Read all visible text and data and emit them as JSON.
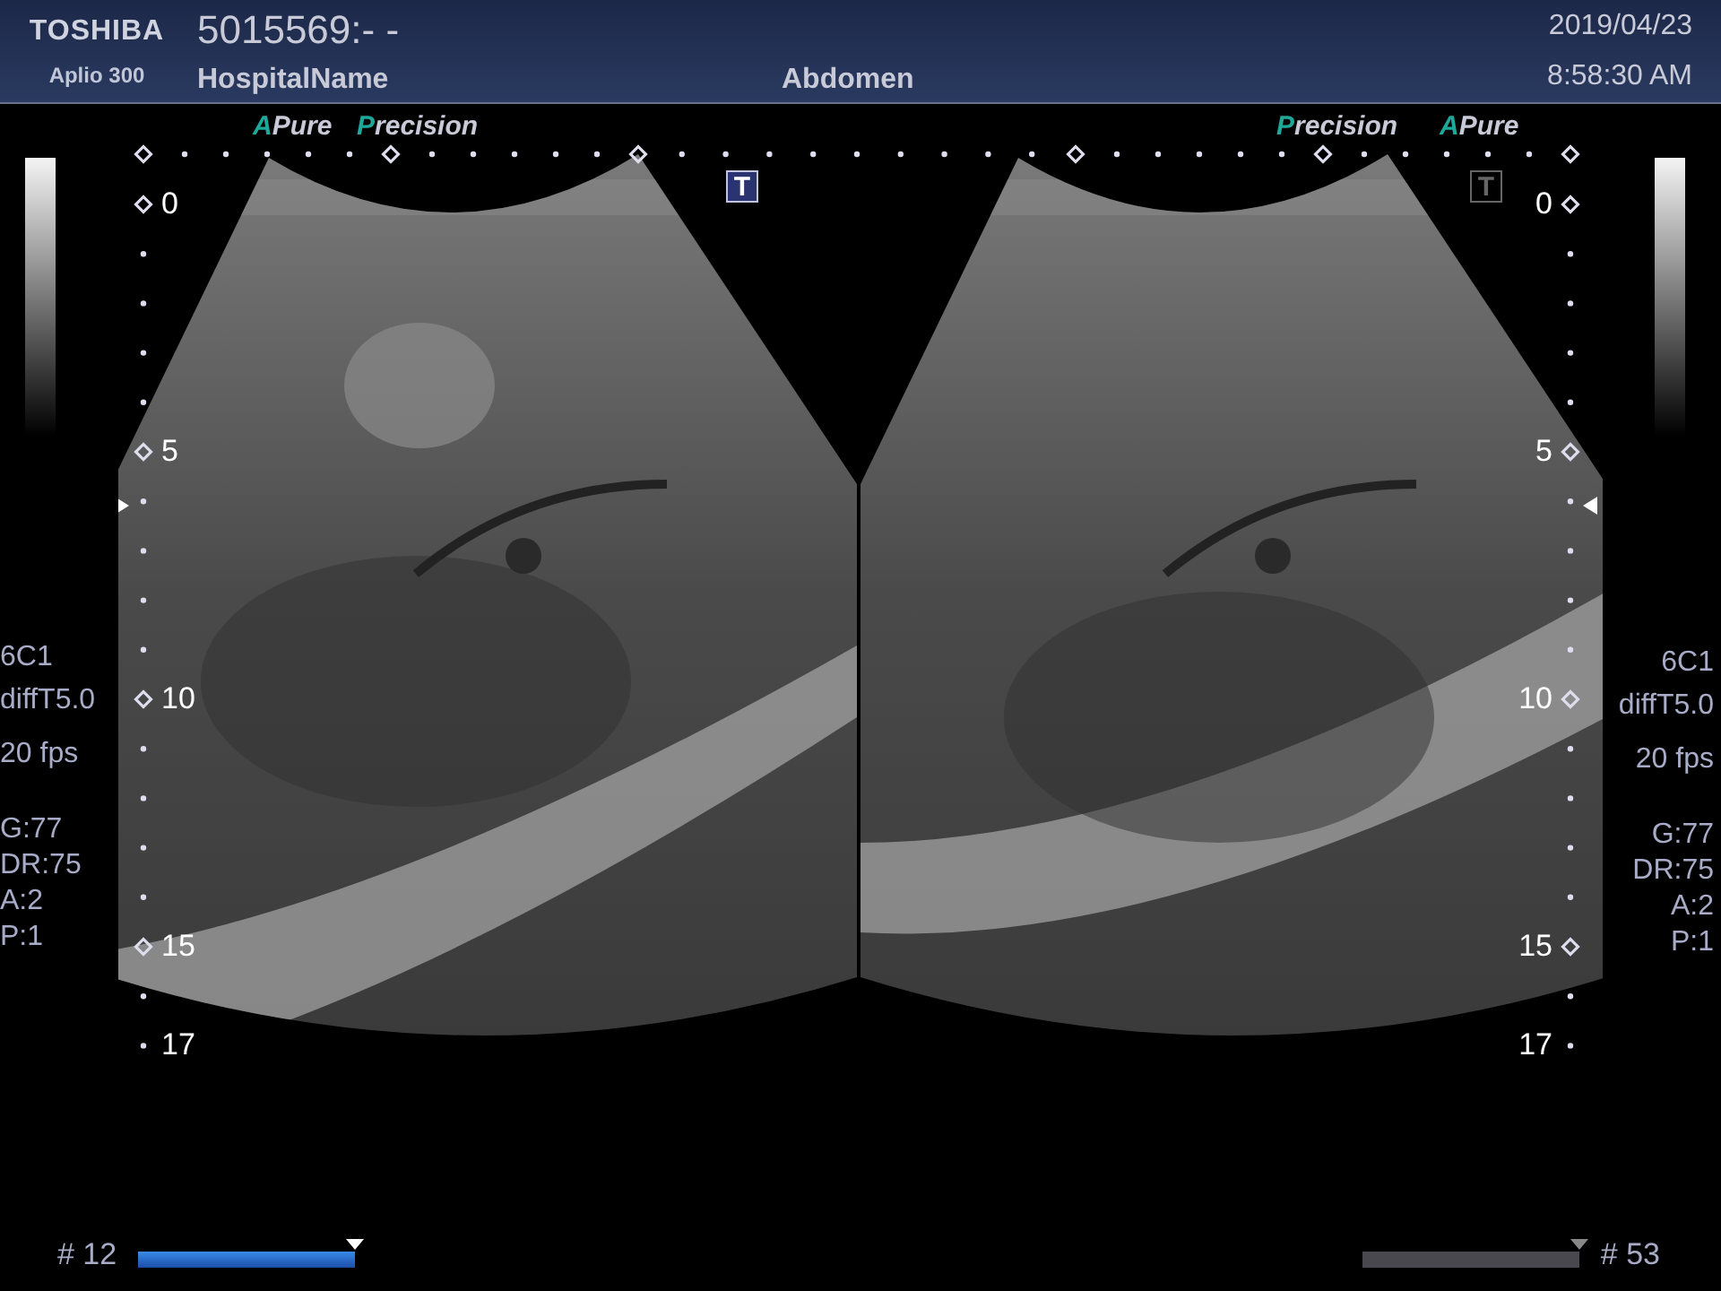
{
  "header": {
    "brand": "TOSHIBA",
    "model": "Aplio 300",
    "patient_id": "5015569:- -",
    "hospital": "HospitalName",
    "exam": "Abdomen",
    "date": "2019/04/23",
    "time": "8:58:30 AM"
  },
  "left_panel": {
    "params": [
      "6C1",
      "diffT5.0",
      "20 fps"
    ],
    "gains": [
      "G:77",
      "DR:75",
      "A:2",
      "P:1"
    ]
  },
  "right_panel": {
    "params": [
      "6C1",
      "diffT5.0",
      "20 fps"
    ],
    "gains": [
      "G:77",
      "DR:75",
      "A:2",
      "P:1"
    ]
  },
  "images": [
    {
      "modes": [
        {
          "accent": "A",
          "rest": "Pure"
        },
        {
          "accent": "P",
          "rest": "recision"
        }
      ],
      "marker": {
        "label": "T",
        "selected": true
      },
      "depths": [
        "0",
        "5",
        "10",
        "15",
        "17"
      ]
    },
    {
      "modes": [
        {
          "accent": "P",
          "rest": "recision"
        },
        {
          "accent": "A",
          "rest": "Pure"
        }
      ],
      "marker": {
        "label": "T",
        "selected": false
      },
      "depths": [
        "0",
        "5",
        "10",
        "15",
        "17"
      ]
    }
  ],
  "cine": [
    {
      "label": "# 12",
      "active": true,
      "level": 1
    },
    {
      "label": "# 53",
      "active": false,
      "level": 1
    }
  ]
}
